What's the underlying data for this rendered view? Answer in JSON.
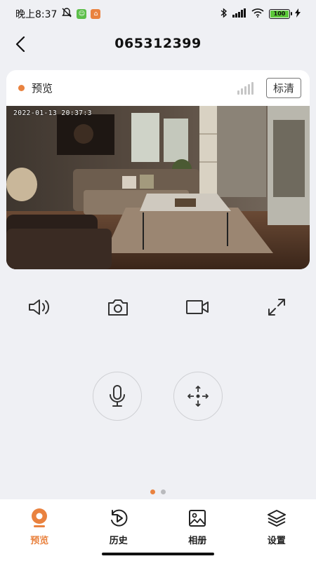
{
  "status_bar": {
    "time": "晚上8:37",
    "battery": "100"
  },
  "header": {
    "title": "065312399"
  },
  "preview_card": {
    "tab_label": "预览",
    "quality_label": "标清",
    "timestamp": "2022-01-13 20:37:3"
  },
  "controls": {
    "icons": [
      "volume-icon",
      "snapshot-icon",
      "record-icon",
      "fullscreen-icon"
    ]
  },
  "actions": {
    "icons": [
      "microphone-icon",
      "ptz-move-icon"
    ]
  },
  "pager": {
    "count": 2,
    "active_index": 0
  },
  "tab_bar": {
    "items": [
      {
        "label": "预览",
        "icon": "camera-icon",
        "active": true
      },
      {
        "label": "历史",
        "icon": "history-play-icon",
        "active": false
      },
      {
        "label": "相册",
        "icon": "image-icon",
        "active": false
      },
      {
        "label": "设置",
        "icon": "layers-icon",
        "active": false
      }
    ]
  },
  "colors": {
    "accent": "#e9823f",
    "background": "#eff0f4",
    "pager_inactive": "#b9babd"
  }
}
